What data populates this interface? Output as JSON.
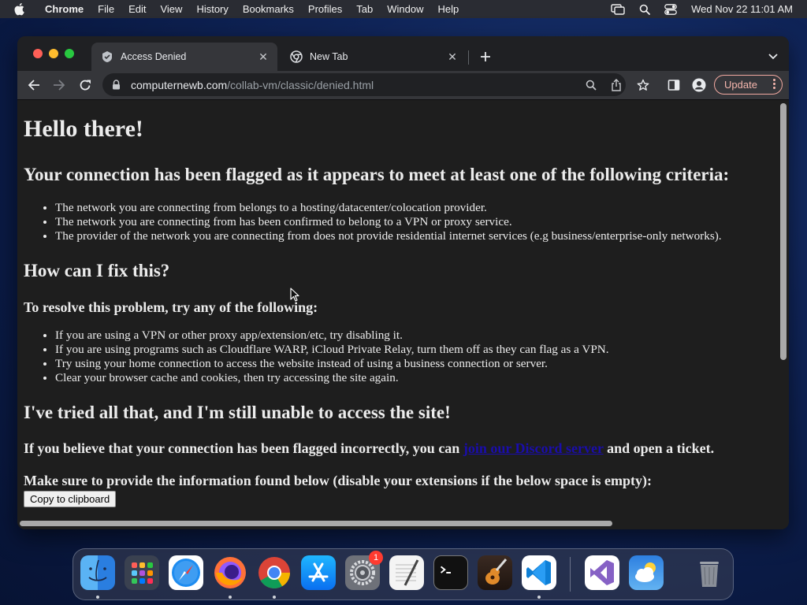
{
  "menubar": {
    "app": "Chrome",
    "items": [
      "File",
      "Edit",
      "View",
      "History",
      "Bookmarks",
      "Profiles",
      "Tab",
      "Window",
      "Help"
    ],
    "clock": "Wed Nov 22  11:01 AM"
  },
  "browser": {
    "tabs": [
      {
        "title": "Access Denied",
        "active": true
      },
      {
        "title": "New Tab",
        "active": false
      }
    ],
    "url_host": "computernewb.com",
    "url_path": "/collab-vm/classic/denied.html",
    "update_label": "Update"
  },
  "page": {
    "title": "Hello there!",
    "criteria_heading": "Your connection has been flagged as it appears to meet at least one of the following criteria:",
    "criteria": [
      "The network you are connecting from belongs to a hosting/datacenter/colocation provider.",
      "The network you are connecting from has been confirmed to belong to a VPN or proxy service.",
      "The provider of the network you are connecting from does not provide residential internet services (e.g business/enterprise-only networks)."
    ],
    "fix_heading": "How can I fix this?",
    "resolve_heading": "To resolve this problem, try any of the following:",
    "fixes": [
      "If you are using a VPN or other proxy app/extension/etc, try disabling it.",
      "If you are using programs such as Cloudflare WARP, iCloud Private Relay, turn them off as they can flag as a VPN.",
      "Try using your home connection to access the website instead of using a business connection or server.",
      "Clear your browser cache and cookies, then try accessing the site again."
    ],
    "tried_heading": "I've tried all that, and I'm still unable to access the site!",
    "incorrect_prefix": "If you believe that your connection has been flagged incorrectly, you can ",
    "discord_link": "join our Discord server",
    "incorrect_suffix": " and open a ticket.",
    "info_heading": "Make sure to provide the information found below (disable your extensions if the below space is empty):",
    "copy_button": "Copy to clipboard"
  },
  "dock": {
    "apps": [
      "finder-icon",
      "launchpad-icon",
      "safari-icon",
      "firefox-icon",
      "chrome-icon",
      "app-store-icon",
      "system-settings-icon",
      "textedit-icon",
      "terminal-icon",
      "garageband-icon",
      "vscode-icon",
      "visual-studio-icon",
      "weather-icon",
      "trash-icon"
    ],
    "settings_badge": "1"
  }
}
